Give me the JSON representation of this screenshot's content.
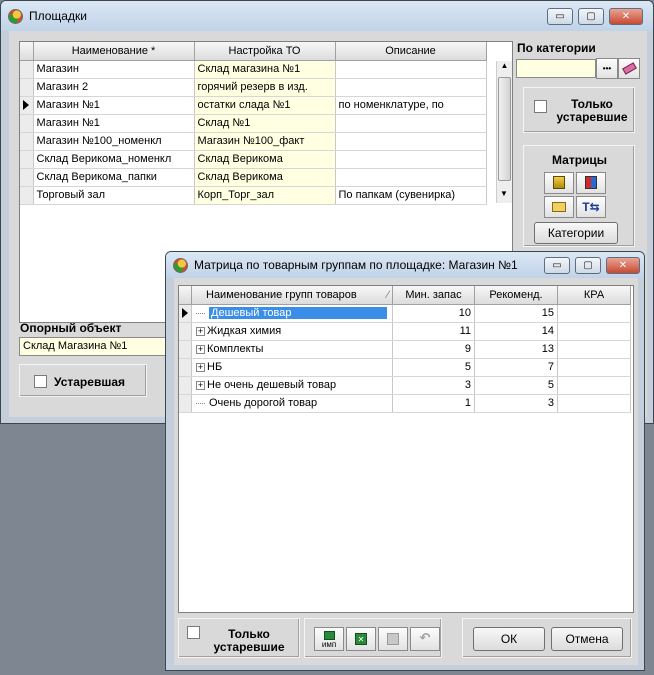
{
  "main_window": {
    "title": "Площадки",
    "columns": [
      "Наименование *",
      "Настройка ТО",
      "Описание"
    ],
    "rows": [
      {
        "name": "Магазин",
        "setting": "Склад магазина №1",
        "desc": ""
      },
      {
        "name": "Магазин 2",
        "setting": "горячий резерв в изд.",
        "desc": ""
      },
      {
        "name": "Магазин №1",
        "setting": "остатки слада №1",
        "desc": "по номенклатуре,  по"
      },
      {
        "name": "Магазин №1",
        "setting": "Склад №1",
        "desc": ""
      },
      {
        "name": "Магазин №100_номенкл",
        "setting": "Магазин №100_факт",
        "desc": ""
      },
      {
        "name": "Склад Верикома_номенкл",
        "setting": "Склад Верикома",
        "desc": ""
      },
      {
        "name": "Склад Верикома_папки",
        "setting": "Склад Верикома",
        "desc": ""
      },
      {
        "name": "Торговый зал",
        "setting": "Корп_Торг_зал",
        "desc": "По папкам (сувенирка)"
      }
    ],
    "category_label": "По категории",
    "category_value": "",
    "ellipsis_label": "•••",
    "only_obsolete_label": "Только устаревшие",
    "matrices_label": "Матрицы",
    "categories_button": "Категории",
    "ref_object_label": "Опорный объект",
    "ref_object_value": "Склад Магазина №1",
    "obsolete_label": "Устаревшая"
  },
  "matrix_window": {
    "title": "Матрица по товарным группам по площадке: Магазин №1",
    "columns": [
      "Наименование групп товаров",
      "Мин. запас",
      "Рекоменд.",
      "КРА"
    ],
    "sort_glyph": "⁄",
    "rows": [
      {
        "name": "Дешевый товар",
        "min": "10",
        "rec": "15",
        "kra": "",
        "expandable": false
      },
      {
        "name": "Жидкая химия",
        "min": "11",
        "rec": "14",
        "kra": "",
        "expandable": true
      },
      {
        "name": "Комплекты",
        "min": "9",
        "rec": "13",
        "kra": "",
        "expandable": true
      },
      {
        "name": "НБ",
        "min": "5",
        "rec": "7",
        "kra": "",
        "expandable": true
      },
      {
        "name": "Не очень дешевый товар",
        "min": "3",
        "rec": "5",
        "kra": "",
        "expandable": true
      },
      {
        "name": "Очень дорогой товар",
        "min": "1",
        "rec": "3",
        "kra": "",
        "expandable": false
      }
    ],
    "only_obsolete_label": "Только устаревшие",
    "import_label": "имп",
    "ok_label": "ОК",
    "cancel_label": "Отмена"
  },
  "window_controls": {
    "minimize": "▭",
    "maximize": "▢",
    "close": "✕"
  }
}
